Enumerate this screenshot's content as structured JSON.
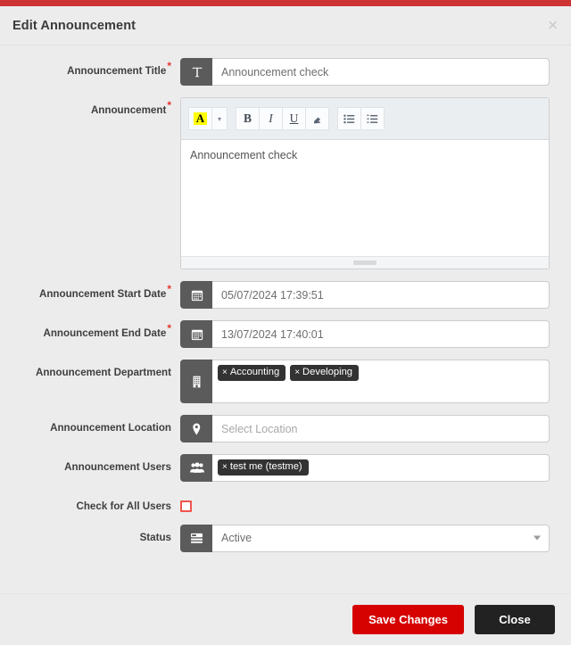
{
  "window": {
    "title": "Edit Announcement",
    "close_icon": "close-icon",
    "accent_color": "#cd3333"
  },
  "form": {
    "title_field": {
      "label": "Announcement Title",
      "required": "*",
      "icon": "text-format-icon",
      "value": "Announcement check"
    },
    "announcement_field": {
      "label": "Announcement",
      "required": "*",
      "content": "Announcement check",
      "toolbar": [
        {
          "name": "highlight-color-button",
          "glyph": "A"
        },
        {
          "name": "highlight-dropdown-button",
          "glyph": "▾"
        },
        {
          "name": "bold-button",
          "glyph": "B"
        },
        {
          "name": "italic-button",
          "glyph": "I"
        },
        {
          "name": "underline-button",
          "glyph": "U"
        },
        {
          "name": "remove-format-button",
          "glyph": "◰"
        },
        {
          "name": "unordered-list-button",
          "glyph": "☰"
        },
        {
          "name": "ordered-list-button",
          "glyph": "☷"
        }
      ]
    },
    "start_date_field": {
      "label": "Announcement Start Date",
      "required": "*",
      "icon": "calendar-icon",
      "value": "05/07/2024 17:39:51"
    },
    "end_date_field": {
      "label": "Announcement End Date",
      "required": "*",
      "icon": "calendar-icon",
      "value": "13/07/2024 17:40:01"
    },
    "department_field": {
      "label": "Announcement Department",
      "icon": "building-icon",
      "tags": [
        {
          "remove": "×",
          "label": "Accounting"
        },
        {
          "remove": "×",
          "label": "Developing"
        }
      ]
    },
    "location_field": {
      "label": "Announcement Location",
      "icon": "map-pin-icon",
      "value": "",
      "placeholder": "Select Location"
    },
    "users_field": {
      "label": "Announcement Users",
      "icon": "users-icon",
      "tags": [
        {
          "remove": "×",
          "label": "test me (testme)"
        }
      ]
    },
    "all_users_field": {
      "label": "Check for All Users",
      "checked": false,
      "checkbox_color": "#f1554c"
    },
    "status_field": {
      "label": "Status",
      "icon": "list-icon",
      "value": "Active",
      "options": [
        "Active"
      ]
    }
  },
  "footer": {
    "save_label": "Save Changes",
    "close_label": "Close",
    "save_color": "#d60202",
    "close_color": "#222222"
  }
}
